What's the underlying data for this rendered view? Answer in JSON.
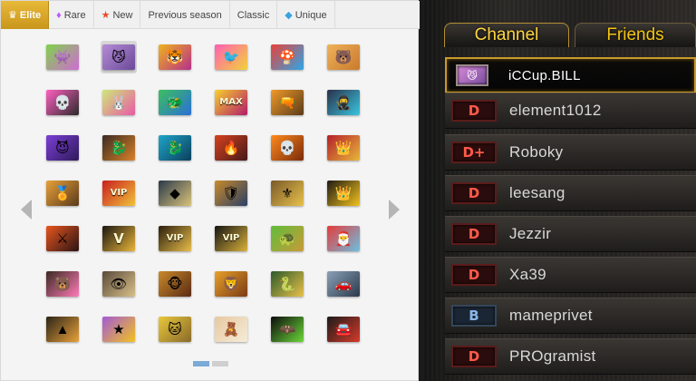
{
  "tabs": [
    {
      "label": "Elite",
      "icon": "crown-icon",
      "glyph": "♛",
      "active": true
    },
    {
      "label": "Rare",
      "icon": "gem-icon",
      "glyph": "♦",
      "active": false
    },
    {
      "label": "New",
      "icon": "star-icon",
      "glyph": "★",
      "active": false
    },
    {
      "label": "Previous season",
      "icon": "",
      "glyph": "",
      "active": false
    },
    {
      "label": "Classic",
      "icon": "",
      "glyph": "",
      "active": false
    },
    {
      "label": "Unique",
      "icon": "diamond-icon",
      "glyph": "◆",
      "active": false
    }
  ],
  "avatars": [
    [
      {
        "name": "avatar-green-monster",
        "glyph": "👾",
        "c1": "#7fd34a",
        "c2": "#d06bd4"
      },
      {
        "name": "avatar-purple-creature",
        "glyph": "😼",
        "c1": "#b48bd6",
        "c2": "#6b4a9a",
        "selected": true
      },
      {
        "name": "avatar-tiger",
        "glyph": "🐯",
        "c1": "#f0b21e",
        "c2": "#b5308a"
      },
      {
        "name": "avatar-pink-bird",
        "glyph": "🐦",
        "c1": "#ff5fb5",
        "c2": "#f2d23a"
      },
      {
        "name": "avatar-plumber",
        "glyph": "🍄",
        "c1": "#e8413a",
        "c2": "#2ea6e6"
      },
      {
        "name": "avatar-bear-fighter",
        "glyph": "🐻",
        "c1": "#f0b25a",
        "c2": "#c97a2b"
      }
    ],
    [
      {
        "name": "avatar-pink-skull",
        "glyph": "💀",
        "c1": "#ff5fc1",
        "c2": "#2b2b2b"
      },
      {
        "name": "avatar-bunny-mask",
        "glyph": "🐰",
        "c1": "#cfe879",
        "c2": "#e85aa5"
      },
      {
        "name": "avatar-green-dragon",
        "glyph": "🐲",
        "c1": "#3dbf5f",
        "c2": "#2a6fd6"
      },
      {
        "name": "avatar-max-logo",
        "glyph": "MAX",
        "c1": "#f7d02c",
        "c2": "#b21b6c",
        "text": true
      },
      {
        "name": "avatar-orange-gunman",
        "glyph": "🔫",
        "c1": "#f09a2a",
        "c2": "#5a3a1a"
      },
      {
        "name": "avatar-dark-ninja",
        "glyph": "🥷",
        "c1": "#2a2f4a",
        "c2": "#39c6e0"
      }
    ],
    [
      {
        "name": "avatar-purple-demon",
        "glyph": "😈",
        "c1": "#7b3fd6",
        "c2": "#2f1a5a"
      },
      {
        "name": "avatar-black-dragon",
        "glyph": "🐉",
        "c1": "#3a2a22",
        "c2": "#d8822a"
      },
      {
        "name": "avatar-ice-dragon",
        "glyph": "🐉",
        "c1": "#1fa5c9",
        "c2": "#0b3f5c"
      },
      {
        "name": "avatar-fire-phoenix",
        "glyph": "🔥",
        "c1": "#d6411e",
        "c2": "#451a1a"
      },
      {
        "name": "avatar-flame-skull",
        "glyph": "💀",
        "c1": "#ff8a1e",
        "c2": "#7a2a0c"
      },
      {
        "name": "avatar-red-crown",
        "glyph": "👑",
        "c1": "#b41e2a",
        "c2": "#e8b73a"
      }
    ],
    [
      {
        "name": "avatar-gold-wings",
        "glyph": "🏅",
        "c1": "#e8a13a",
        "c2": "#5a3a1a"
      },
      {
        "name": "avatar-vip-red",
        "glyph": "VIP",
        "c1": "#c91e1e",
        "c2": "#f0c23a",
        "text": true
      },
      {
        "name": "avatar-diamond-badge",
        "glyph": "◆",
        "c1": "#2a3a4a",
        "c2": "#d9c27a"
      },
      {
        "name": "avatar-rank-shield",
        "glyph": "🛡",
        "c1": "#c98a2a",
        "c2": "#2a3f66"
      },
      {
        "name": "avatar-gold-shield",
        "glyph": "⚜",
        "c1": "#7a5a2a",
        "c2": "#e8c14a"
      },
      {
        "name": "avatar-gold-crown",
        "glyph": "👑",
        "c1": "#1f1a14",
        "c2": "#f2c21e"
      }
    ],
    [
      {
        "name": "avatar-fire-blades",
        "glyph": "⚔",
        "c1": "#e8551e",
        "c2": "#2a1414"
      },
      {
        "name": "avatar-gold-v",
        "glyph": "V",
        "c1": "#1a1610",
        "c2": "#e8b53a",
        "text": true
      },
      {
        "name": "avatar-vip-gold",
        "glyph": "VIP",
        "c1": "#2a1e0c",
        "c2": "#e8bd4a",
        "text": true
      },
      {
        "name": "avatar-vip-black",
        "glyph": "VIP",
        "c1": "#141414",
        "c2": "#d9b03a",
        "text": true
      },
      {
        "name": "avatar-turtle",
        "glyph": "🐢",
        "c1": "#5fbd3a",
        "c2": "#c99a3a"
      },
      {
        "name": "avatar-santa-cat",
        "glyph": "🎅",
        "c1": "#e83a3a",
        "c2": "#6ac0e0"
      }
    ],
    [
      {
        "name": "avatar-pink-bear",
        "glyph": "🐻",
        "c1": "#3a2a22",
        "c2": "#ff7ab8"
      },
      {
        "name": "avatar-eye-pyramid",
        "glyph": "👁",
        "c1": "#5a4a3a",
        "c2": "#d8c08a"
      },
      {
        "name": "avatar-monkey-king",
        "glyph": "🐵",
        "c1": "#c98a2a",
        "c2": "#5a2a14"
      },
      {
        "name": "avatar-winged-lion",
        "glyph": "🦁",
        "c1": "#e8a12a",
        "c2": "#7a3a14"
      },
      {
        "name": "avatar-green-dragon-emblem",
        "glyph": "🐍",
        "c1": "#2a5a2a",
        "c2": "#e8c14a"
      },
      {
        "name": "avatar-silver-car",
        "glyph": "🚗",
        "c1": "#8aa0b8",
        "c2": "#2a3a4a"
      }
    ],
    [
      {
        "name": "avatar-dark-pyramid",
        "glyph": "▲",
        "c1": "#2a2418",
        "c2": "#e8a13a"
      },
      {
        "name": "avatar-gold-star",
        "glyph": "★",
        "c1": "#a35ad6",
        "c2": "#f2c21e"
      },
      {
        "name": "avatar-totoro",
        "glyph": "🐱",
        "c1": "#e8c83a",
        "c2": "#8a6a2a"
      },
      {
        "name": "avatar-teddy-bear",
        "glyph": "🧸",
        "c1": "#e8c8a0",
        "c2": "#f4ecd8"
      },
      {
        "name": "avatar-bat-cat",
        "glyph": "🦇",
        "c1": "#0c0c0c",
        "c2": "#6bd63a"
      },
      {
        "name": "avatar-black-car",
        "glyph": "🚘",
        "c1": "#1a1a1a",
        "c2": "#d63a2a"
      }
    ]
  ],
  "pagination": {
    "pages": 2,
    "current": 1
  },
  "channel": {
    "tabs": [
      {
        "label": "Channel",
        "active": true
      },
      {
        "label": "Friends",
        "active": false
      }
    ],
    "users": [
      {
        "name": "iCCup.BILL",
        "rank": "",
        "selected": true
      },
      {
        "name": "element1012",
        "rank": "D"
      },
      {
        "name": "Roboky",
        "rank": "D+"
      },
      {
        "name": "leesang",
        "rank": "D"
      },
      {
        "name": "Jezzir",
        "rank": "D"
      },
      {
        "name": "Xa39",
        "rank": "D"
      },
      {
        "name": "mameprivet",
        "rank": "B"
      },
      {
        "name": "PROgramist",
        "rank": "D"
      }
    ]
  }
}
